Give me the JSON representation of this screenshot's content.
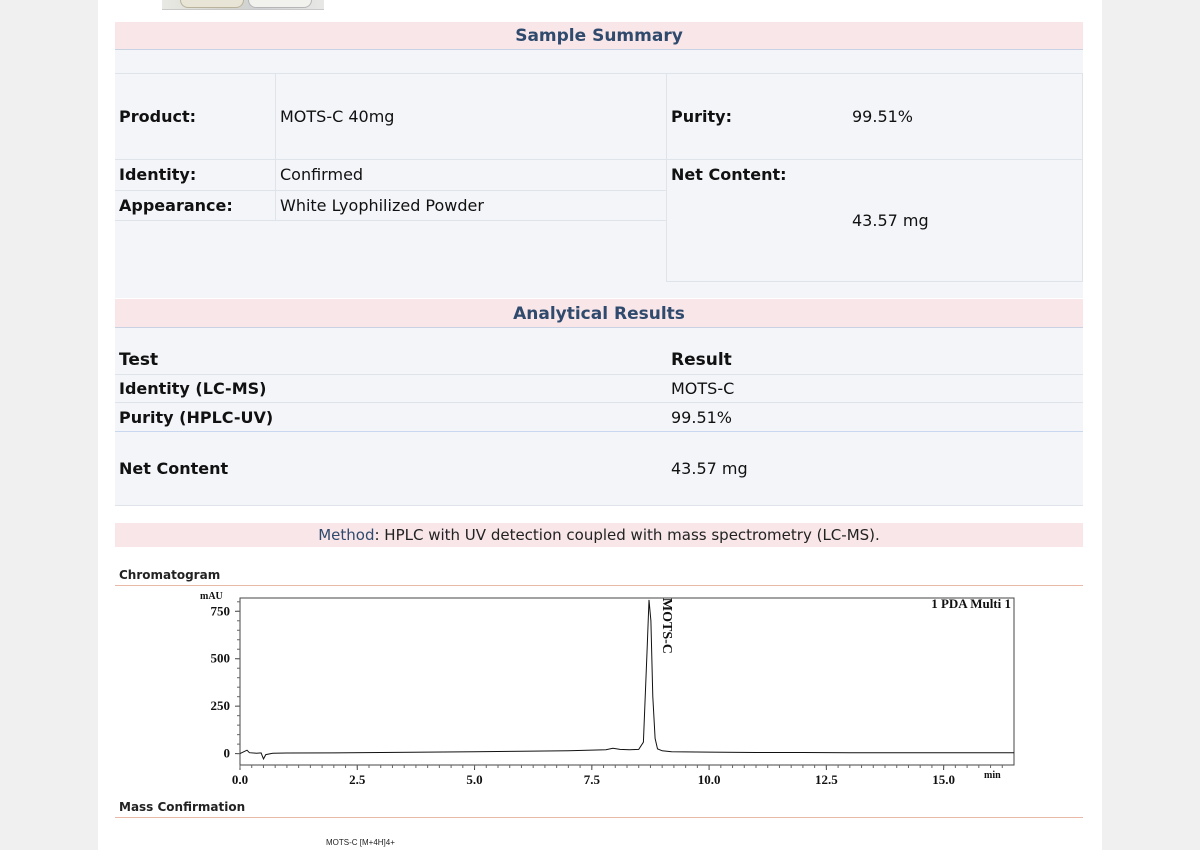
{
  "sample_summary": {
    "title": "Sample Summary",
    "product_label": "Product:",
    "product_value": "MOTS-C 40mg",
    "identity_label": "Identity:",
    "identity_value": "Confirmed",
    "appearance_label": "Appearance:",
    "appearance_value": "White Lyophilized Powder",
    "purity_label": "Purity:",
    "purity_value": "99.51%",
    "net_content_label": "Net Content:",
    "net_content_value": "43.57 mg"
  },
  "analytical_results": {
    "title": "Analytical Results",
    "header_test": "Test",
    "header_result": "Result",
    "rows": [
      {
        "test": "Identity (LC-MS)",
        "result": "MOTS-C"
      },
      {
        "test": "Purity (HPLC-UV)",
        "result": "99.51%"
      },
      {
        "test": "Net Content",
        "result": "43.57 mg"
      }
    ]
  },
  "method": {
    "label": "Method",
    "text": ": HPLC with UV detection coupled with mass spectrometry (LC-MS)."
  },
  "chromatogram_heading": "Chromatogram",
  "mass_heading": "Mass Confirmation",
  "mass_peak_label": "MOTS-C [M+4H]4+",
  "chart_data": {
    "type": "line",
    "title": "",
    "ylabel": "mAU",
    "xlabel": "min",
    "legend": "1 PDA Multi 1",
    "xlim": [
      0.0,
      16.5
    ],
    "ylim": [
      -60,
      820
    ],
    "x_ticks": [
      "0.0",
      "2.5",
      "5.0",
      "7.5",
      "10.0",
      "12.5",
      "15.0"
    ],
    "y_ticks": [
      "0",
      "250",
      "500",
      "750"
    ],
    "peak_label": "MOTS-C",
    "series": [
      {
        "x": [
          0.0,
          0.15,
          0.2,
          0.35,
          0.45,
          0.5,
          0.55,
          0.7,
          1.0,
          2.0,
          3.0,
          4.0,
          5.0,
          6.0,
          7.0,
          7.8,
          7.95,
          8.1,
          8.3,
          8.5,
          8.6,
          8.68,
          8.72,
          8.76,
          8.8,
          8.85,
          8.9,
          9.0,
          9.2,
          10.0,
          11.0,
          12.0,
          13.0,
          14.0,
          15.0,
          16.5
        ],
        "y": [
          0,
          18,
          5,
          2,
          4,
          -28,
          -5,
          2,
          3,
          4,
          6,
          8,
          10,
          12,
          15,
          20,
          28,
          22,
          20,
          22,
          60,
          560,
          810,
          700,
          300,
          80,
          25,
          15,
          10,
          8,
          6,
          6,
          5,
          5,
          5,
          5
        ]
      }
    ]
  },
  "colors": {
    "section_bar_bg": "#f8e6e8",
    "heading_text": "#2f4a6d",
    "table_bg": "#f3f5f9"
  }
}
